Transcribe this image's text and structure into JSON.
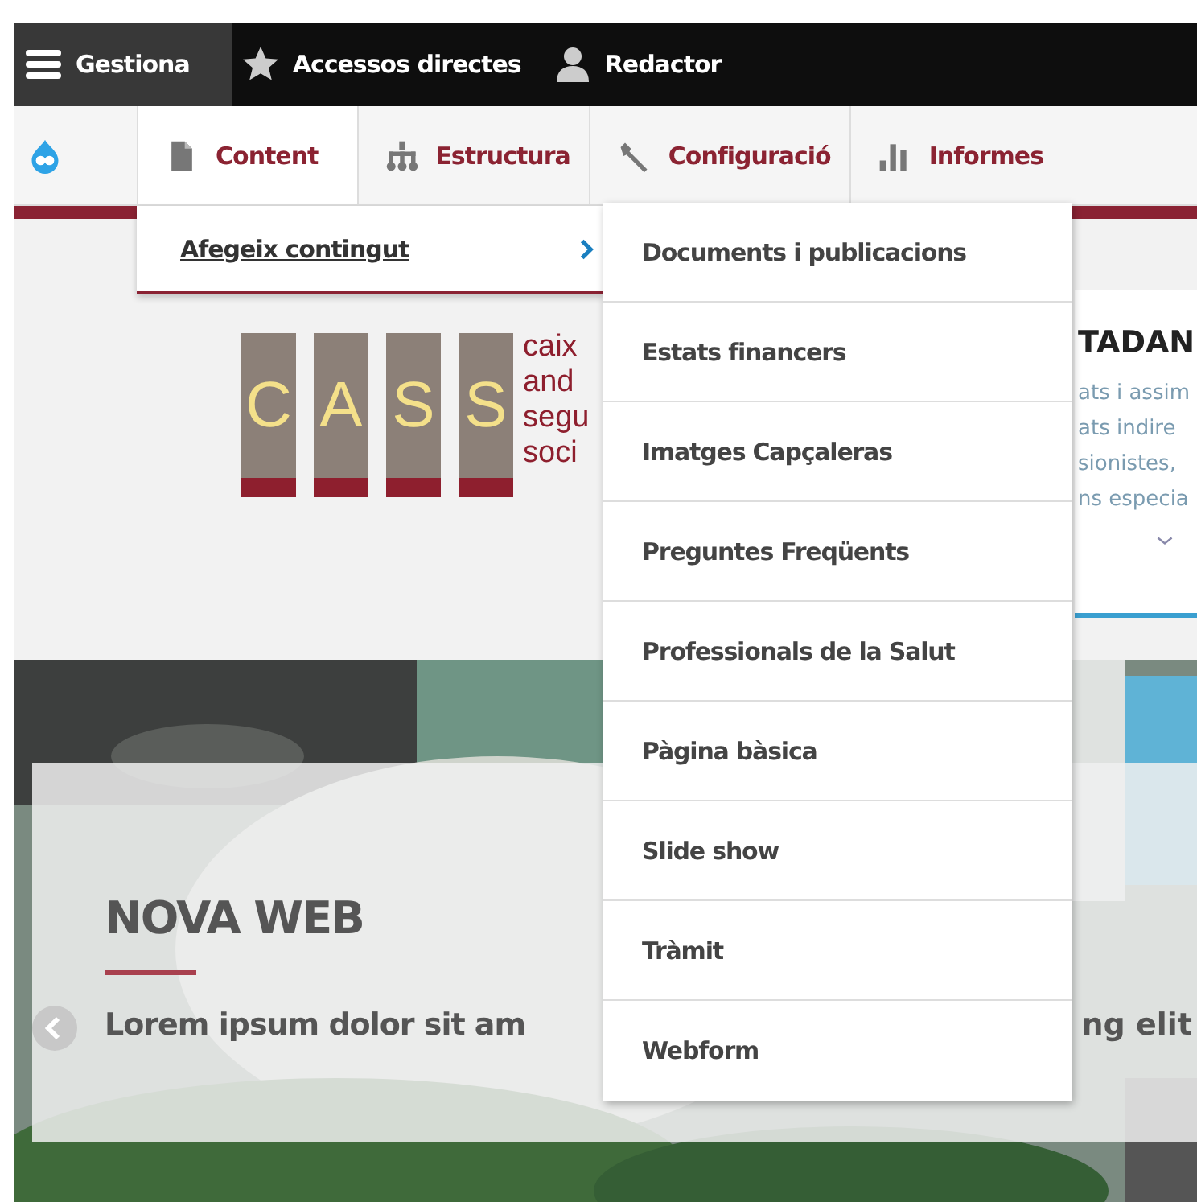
{
  "toolbar": {
    "items": [
      {
        "label": "Gestiona",
        "selected": true
      },
      {
        "label": "Accessos directes",
        "selected": false
      },
      {
        "label": "Redactor",
        "selected": false
      }
    ]
  },
  "tray": {
    "tabs": [
      {
        "label": "Content",
        "selected": true
      },
      {
        "label": "Estructura",
        "selected": false
      },
      {
        "label": "Configuració",
        "selected": false
      },
      {
        "label": "Informes",
        "selected": false
      }
    ]
  },
  "submenu": {
    "label": "Afegeix contingut",
    "expanded": true
  },
  "content_types": [
    "Documents i publicacions",
    "Estats financers",
    "Imatges Capçaleras",
    "Preguntes Freqüents",
    "Professionals de la Salut",
    "Pàgina bàsica",
    "Slide show",
    "Tràmit",
    "Webform"
  ],
  "logo": {
    "letters": [
      "C",
      "A",
      "S",
      "S"
    ],
    "words": [
      "caix",
      "and",
      "segu",
      "soci"
    ]
  },
  "side_card": {
    "title": "TADAN",
    "lines": [
      "ats i assim",
      "ats indire",
      "sionistes,",
      "ns especia"
    ]
  },
  "hero": {
    "kind": "picture",
    "title": "NOVA WEB",
    "text_left": "Lorem ipsum dolor sit am",
    "text_right": "ng elit"
  }
}
